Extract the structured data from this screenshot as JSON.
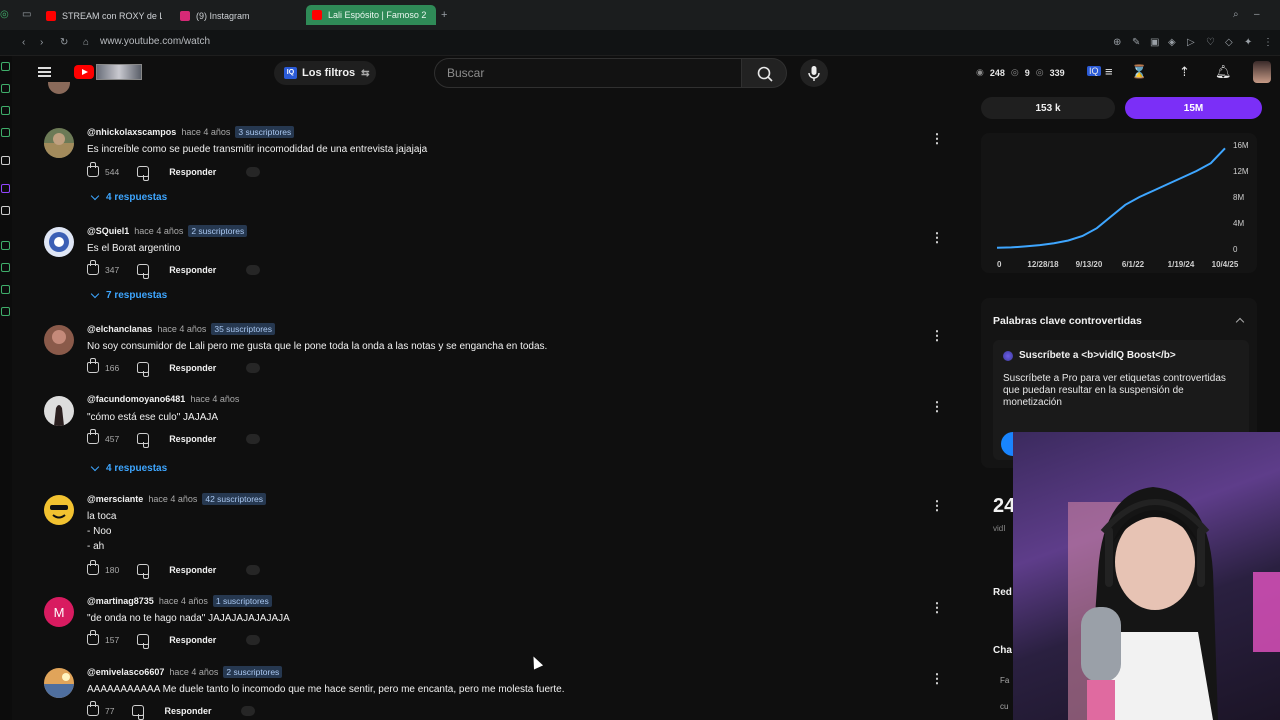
{
  "browser": {
    "tabs": [
      {
        "label": "STREAM con ROXY de La",
        "color": "#ff0000"
      },
      {
        "label": "(9) Instagram",
        "color": "#d62976"
      },
      {
        "label": "Lali Espósito | Famoso 2",
        "color": "#ff0000"
      }
    ],
    "new_tab": "+",
    "url": "www.youtube.com/watch"
  },
  "masthead": {
    "filters_label": "Los filtros",
    "filters_badge": "IQ",
    "search_placeholder": "Buscar",
    "stats": {
      "likes": "248",
      "dislikes": "9",
      "views": "339"
    }
  },
  "comments": [
    {
      "author": "@nhickolaxscampos",
      "time": "hace 4 años",
      "subs": "3 suscriptores",
      "text": [
        "Es increíble como se puede transmitir incomodidad de una entrevista jajajaja"
      ],
      "likes": "544",
      "reply": "Responder",
      "replies": "4 respuestas"
    },
    {
      "author": "@SQuiel1",
      "time": "hace 4 años",
      "subs": "2 suscriptores",
      "text": [
        "Es el Borat argentino"
      ],
      "likes": "347",
      "reply": "Responder",
      "replies": "7 respuestas"
    },
    {
      "author": "@elchanclanas",
      "time": "hace 4 años",
      "subs": "35 suscriptores",
      "text": [
        "No soy consumidor de Lali pero me gusta que le pone toda la onda a las notas y se engancha en todas."
      ],
      "likes": "166",
      "reply": "Responder",
      "replies": ""
    },
    {
      "author": "@facundomoyano6481",
      "time": "hace 4 años",
      "subs": "",
      "text": [
        "\"cómo está ese culo\" JAJAJA"
      ],
      "likes": "457",
      "reply": "Responder",
      "replies": "4 respuestas"
    },
    {
      "author": "@mersciante",
      "time": "hace 4 años",
      "subs": "42 suscriptores",
      "text": [
        "la toca",
        "- Noo",
        "- ah"
      ],
      "likes": "180",
      "reply": "Responder",
      "replies": ""
    },
    {
      "author": "@martinag8735",
      "time": "hace 4 años",
      "subs": "1 suscriptores",
      "text": [
        "\"de onda no te hago nada\" JAJAJAJAJAJAJA"
      ],
      "likes": "157",
      "reply": "Responder",
      "replies": "",
      "avatar_letter": "M"
    },
    {
      "author": "@emivelasco6607",
      "time": "hace 4 años",
      "subs": "2 suscriptores",
      "text": [
        "AAAAAAAAAAA Me duele tanto lo incomodo que me hace sentir, pero me encanta, pero me molesta fuerte."
      ],
      "likes": "77",
      "reply": "Responder",
      "replies": ""
    }
  ],
  "vidiq": {
    "tab_left": "153 k",
    "tab_right": "15M",
    "accent": "#7b2ff7",
    "keywords_title": "Palabras clave controvertidas",
    "keywords_sub": "Suscríbete a <b>vidIQ Boost</b>",
    "keywords_desc": "Suscríbete a Pro para ver etiquetas controvertidas que puedan resultar en la suspensión de monetización",
    "big_number": "24",
    "big_label": "vidI",
    "section_1": "Red",
    "section_2": "Cha",
    "mini_1": "Fa",
    "mini_2": "cu"
  },
  "chart_data": {
    "type": "line",
    "series": [
      {
        "values": [
          0.2,
          0.25,
          0.4,
          0.6,
          0.9,
          1.3,
          2.0,
          3.2,
          5.0,
          6.8,
          8.0,
          9.0,
          10.0,
          11.0,
          12.0,
          13.2,
          15.5
        ]
      }
    ],
    "x_ticks": [
      "0",
      "12/28/18",
      "9/13/20",
      "6/1/22",
      "1/19/24",
      "10/4/25"
    ],
    "y_ticks": [
      "16M",
      "12M",
      "8M",
      "4M",
      "0"
    ],
    "ylim": [
      0,
      16
    ],
    "color": "#3ea6ff"
  }
}
